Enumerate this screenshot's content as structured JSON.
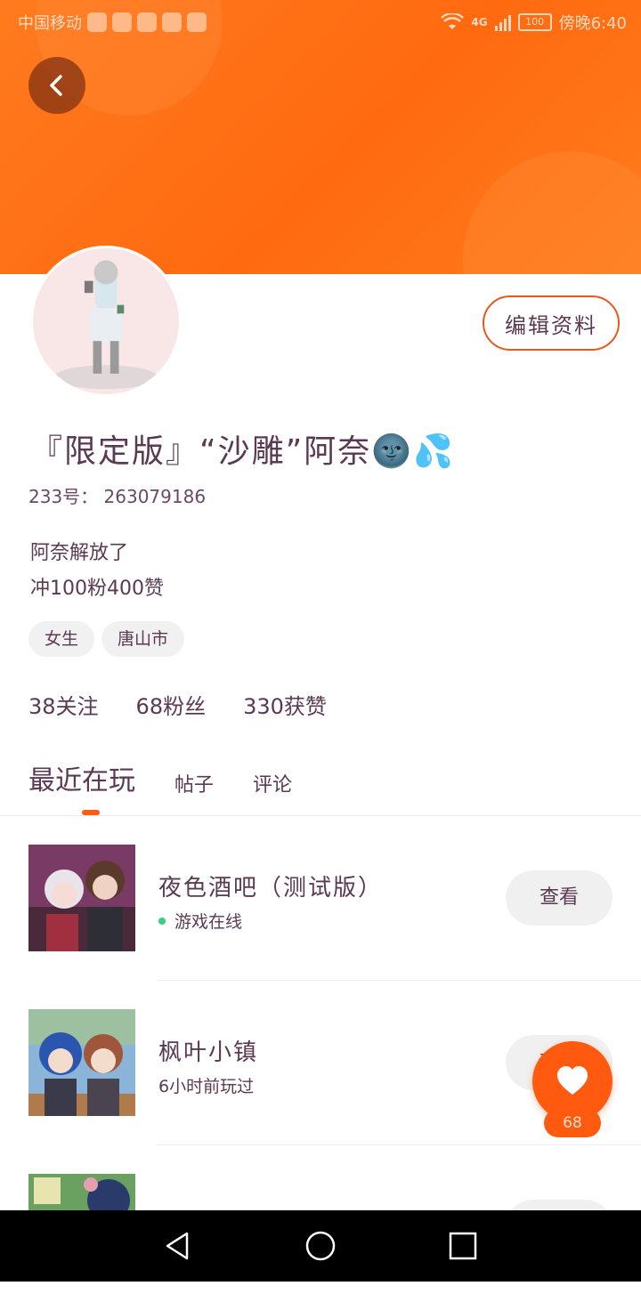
{
  "status_bar": {
    "carrier": "中国移动",
    "network": "4G",
    "battery": "100",
    "time": "傍晚6:40"
  },
  "profile": {
    "edit_label": "编辑资料",
    "nickname": "『限定版』“沙雕”阿奈",
    "nickname_emojis": "🌚💦",
    "user_id": "233号： 263079186",
    "bio_line1": "阿奈解放了",
    "bio_line2": "冲100粉400赞",
    "tags": [
      "女生",
      "唐山市"
    ],
    "stats": {
      "following": "38关注",
      "fans": "68粉丝",
      "likes": "330获赞"
    }
  },
  "tabs": [
    "最近在玩",
    "帖子",
    "评论"
  ],
  "games": [
    {
      "title": "夜色酒吧（测试版）",
      "status": "游戏在线",
      "online": true,
      "action": "查看"
    },
    {
      "title": "枫叶小镇",
      "status": "6小时前玩过",
      "online": false,
      "action": "查看"
    },
    {
      "title": "",
      "status": "",
      "online": false,
      "action": ""
    }
  ],
  "like_fab": {
    "count": "68"
  },
  "colors": {
    "accent": "#ff5a10",
    "header": "#ff7a1e",
    "online": "#35d07f"
  }
}
